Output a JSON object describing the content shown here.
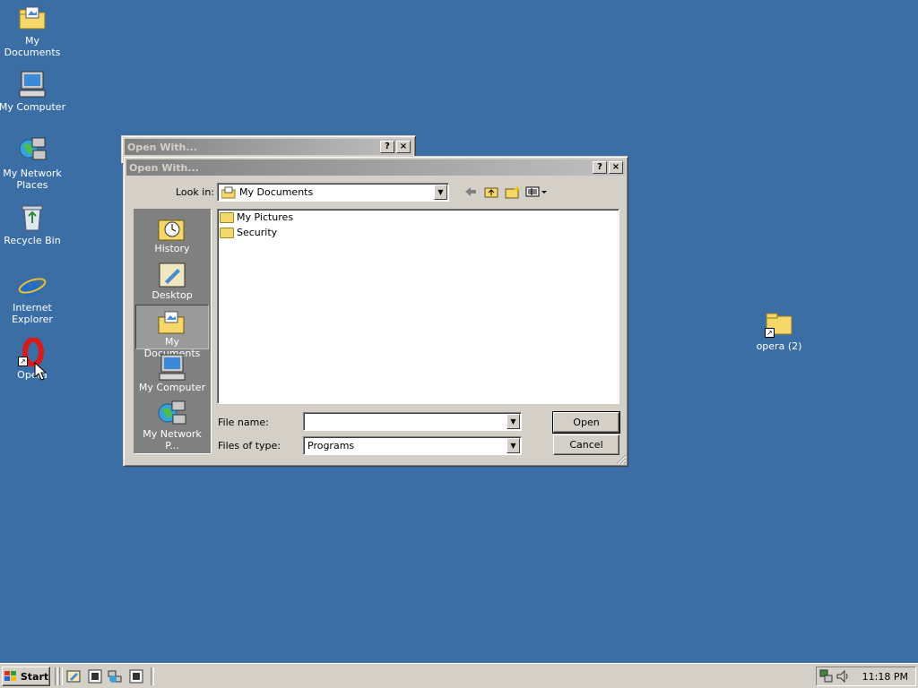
{
  "desktop": {
    "icons": [
      {
        "label": "My Documents"
      },
      {
        "label": "My Computer"
      },
      {
        "label": "My Network Places"
      },
      {
        "label": "Recycle Bin"
      },
      {
        "label": "Internet Explorer"
      },
      {
        "label": "Opera"
      },
      {
        "label": "opera (2)"
      }
    ]
  },
  "back_window": {
    "title": "Open With..."
  },
  "dialog": {
    "title": "Open With...",
    "look_in_label": "Look in:",
    "look_in_value": "My Documents",
    "places": [
      "History",
      "Desktop",
      "My Documents",
      "My Computer",
      "My Network P..."
    ],
    "files": [
      "My Pictures",
      "Security"
    ],
    "file_name_label": "File name:",
    "file_name_value": "",
    "files_of_type_label": "Files of type:",
    "files_of_type_value": "Programs",
    "open_label": "Open",
    "cancel_label": "Cancel",
    "help_glyph": "?",
    "close_glyph": "×"
  },
  "taskbar": {
    "start_label": "Start",
    "clock": "11:18 PM"
  },
  "colors": {
    "desktop": "#3a6ea5",
    "face": "#d4d0c8"
  }
}
